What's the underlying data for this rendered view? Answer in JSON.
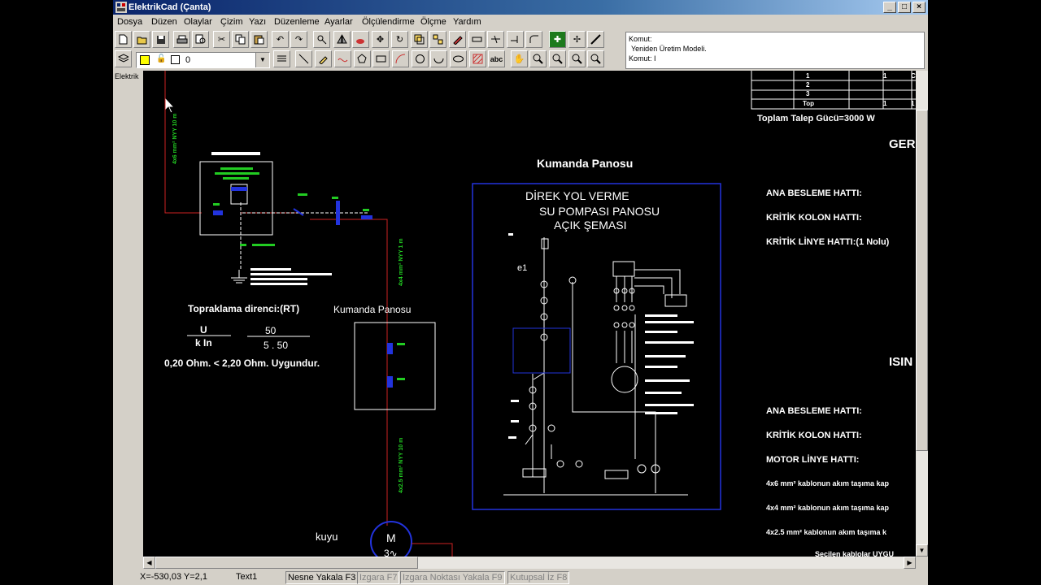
{
  "window": {
    "title": "ElektrikCad (Çanta)",
    "controls": {
      "minimize": "_",
      "maximize": "□",
      "close": "×"
    }
  },
  "menu": [
    "Dosya",
    "Düzen",
    "Olaylar",
    "Çizim",
    "Yazı",
    "Düzenleme",
    "Ayarlar",
    "Ölçülendirme",
    "Ölçme",
    "Yardım"
  ],
  "toolbar": {
    "layer_value": "0",
    "text_tool_label": "abc"
  },
  "command": {
    "line1": "Komut:",
    "line2": "Yeniden Üretim Modeli.",
    "line3": "Komut:  I"
  },
  "sidebar": {
    "label": "Elektrik"
  },
  "drawing": {
    "table_rows": [
      {
        "label": "1",
        "c1": "",
        "c2": "1",
        "c3": "C"
      },
      {
        "label": "2",
        "c1": "",
        "c2": "",
        "c3": ""
      },
      {
        "label": "3",
        "c1": "",
        "c2": "",
        "c3": ""
      },
      {
        "label": "Top",
        "c1": "",
        "c2": "1",
        "c3": "1"
      }
    ],
    "total_power": "Toplam Talep Gücü=3000 W",
    "side_heading_1": "GER",
    "side_heading_2": "ISIN",
    "right_labels_1": [
      "ANA BESLEME HATTI:",
      "KRİTİK KOLON HATTI:",
      "KRİTİK LİNYE HATTI:(1 Nolu)"
    ],
    "right_labels_2": [
      "ANA BESLEME HATTI:",
      "KRİTİK KOLON HATTI:",
      "MOTOR LİNYE HATTI:"
    ],
    "cable_notes": [
      "4x6 mm² kablonun akım taşıma kap",
      "4x4 mm² kablonun akım taşıma kap",
      "4x2.5 mm² kablonun akım taşıma k"
    ],
    "bottom_note": "Seçilen kablolar UYGU",
    "cable_label_top": "4x6 mm² NYY 10 m",
    "cable_label_mid": "4x4 mm² NYY 1 m",
    "cable_label_bottom": "4x2.5 mm² NYY 10 m",
    "panel_title": "Kumanda Panosu",
    "panel_title_small": "Kumanda Panosu",
    "panel_heading_1": "DİREK YOL VERME",
    "panel_heading_2": "SU POMPASI PANOSU",
    "panel_heading_3": "AÇIK ŞEMASI",
    "panel_e1": "e1",
    "grounding_title": "Topraklama direnci:(RT)",
    "formula_num": "U",
    "formula_den": "k In",
    "formula_num2": "50",
    "formula_den2": "5 . 50",
    "grounding_result": "0,20 Ohm. < 2,20 Ohm.  Uygundur.",
    "well_label": "kuyu",
    "motor_label": "M",
    "motor_phase": "3∿"
  },
  "status": {
    "coords": "X=-530,03   Y=2,1",
    "mode": "Text1",
    "toggles": [
      {
        "label": "Nesne Yakala F3",
        "on": true
      },
      {
        "label": "Izgara F7",
        "on": false
      },
      {
        "label": "Izgara Noktası Yakala  F9",
        "on": false
      },
      {
        "label": "Kutupsal İz  F8",
        "on": false
      }
    ]
  },
  "colors": {
    "accent": "#0a246a",
    "drawing_green": "#22cc22",
    "drawing_red": "#cc2222",
    "drawing_blue": "#2233dd"
  }
}
